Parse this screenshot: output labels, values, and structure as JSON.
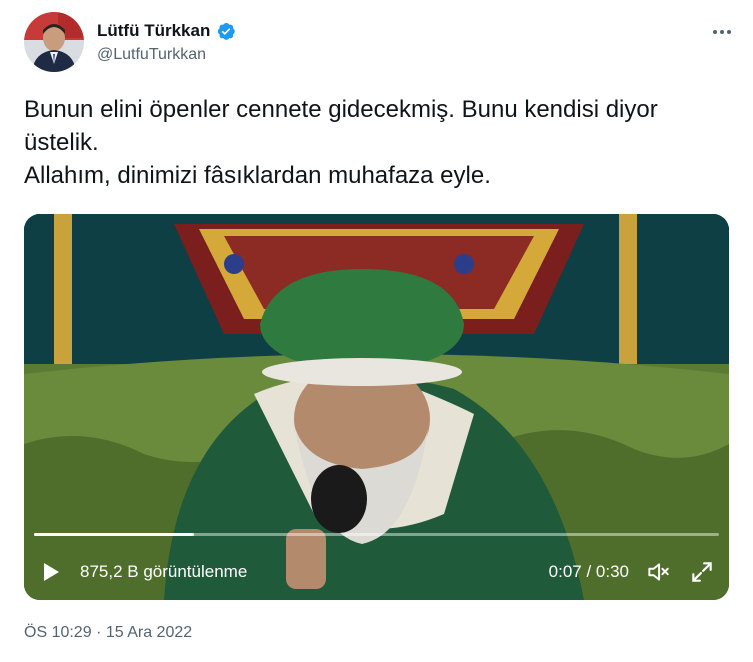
{
  "author": {
    "name": "Lütfü Türkkan",
    "handle": "@LutfuTurkkan",
    "verified": true,
    "verified_color": "#1d9bf0"
  },
  "tweet": {
    "lines": [
      "Bunun elini öpenler cennete gidecekmiş. Bunu kendisi diyor üstelik.",
      "Allahım, dinimizi fâsıklardan muhafaza eyle."
    ]
  },
  "video": {
    "views": "875,2 B görüntülenme",
    "time": "0:07 / 0:30",
    "progress": 0.233,
    "icons": [
      "play-icon",
      "volume-icon",
      "fullscreen-icon"
    ]
  },
  "meta": {
    "time": "ÖS 10:29",
    "separator": "·",
    "date": "15 Ara 2022"
  },
  "icons": {
    "more": "more-icon"
  }
}
